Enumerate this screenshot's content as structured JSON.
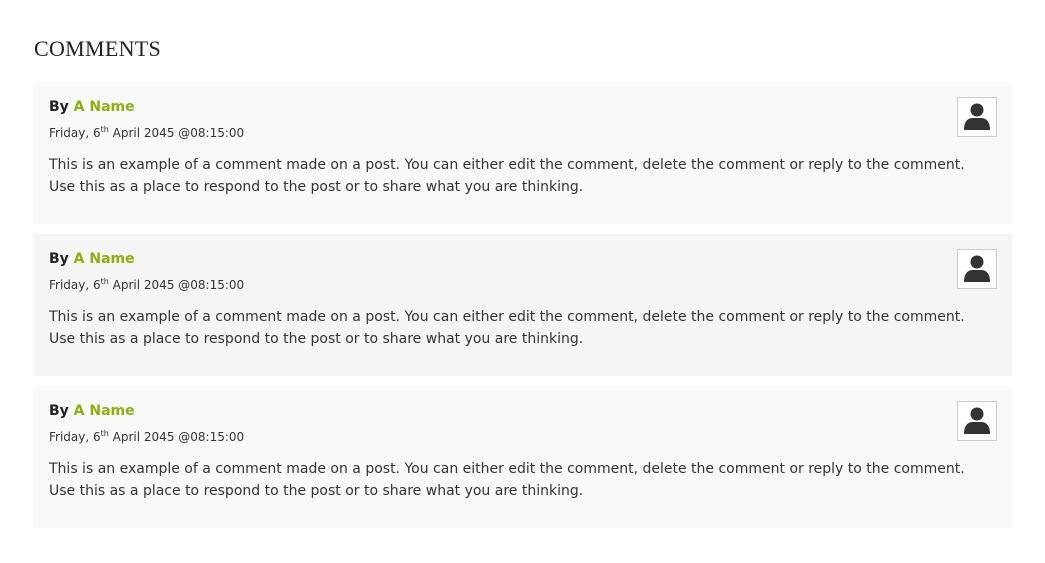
{
  "section_title": "COMMENTS",
  "comments": [
    {
      "by_label": "By",
      "author": "A Name",
      "date_prefix": "Friday, 6",
      "date_suffix": "th",
      "date_rest": " April 2045 @08:15:00",
      "body_line1": "This is an example of a comment made on a post. You can either edit the comment, delete the comment or reply to the comment.",
      "body_line2": "Use this as a place to respond to the post or to share what you are thinking.",
      "avatar_icon": "user-icon"
    },
    {
      "by_label": "By",
      "author": "A Name",
      "date_prefix": "Friday, 6",
      "date_suffix": "th",
      "date_rest": " April 2045 @08:15:00",
      "body_line1": "This is an example of a comment made on a post. You can either edit the comment, delete the comment or reply to the comment.",
      "body_line2": "Use this as a place to respond to the post or to share what you are thinking.",
      "avatar_icon": "user-icon"
    },
    {
      "by_label": "By",
      "author": "A Name",
      "date_prefix": "Friday, 6",
      "date_suffix": "th",
      "date_rest": " April 2045 @08:15:00",
      "body_line1": "This is an example of a comment made on a post. You can either edit the comment, delete the comment or reply to the comment.",
      "body_line2": "Use this as a place to respond to the post or to share what you are thinking.",
      "avatar_icon": "user-icon"
    }
  ],
  "colors": {
    "accent": "#8cb10a",
    "card_background": "#f9f9f9",
    "card_background_alt": "#f5f5f5"
  }
}
